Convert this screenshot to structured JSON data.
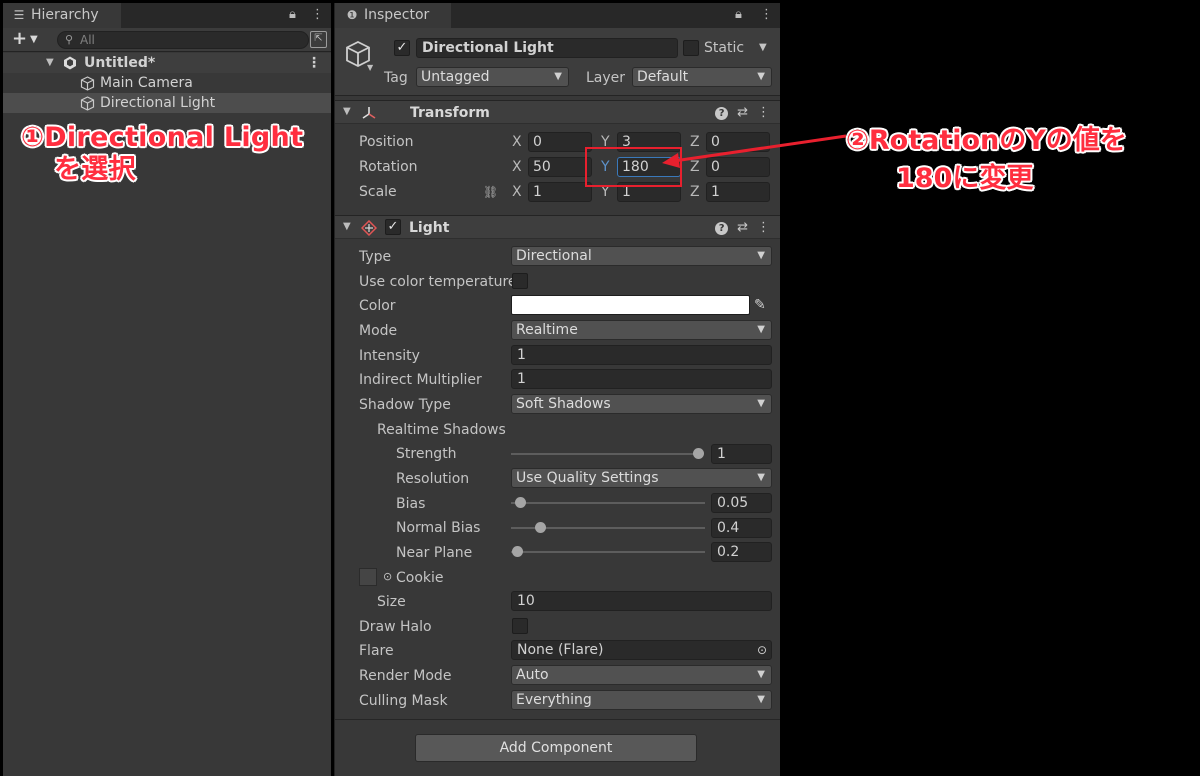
{
  "hierarchy": {
    "tab_label": "Hierarchy",
    "search_placeholder": "All",
    "scene_name": "Untitled*",
    "items": [
      "Main Camera",
      "Directional Light"
    ]
  },
  "inspector": {
    "tab_label": "Inspector",
    "object_name": "Directional Light",
    "static_label": "Static",
    "tag_label": "Tag",
    "tag_value": "Untagged",
    "layer_label": "Layer",
    "layer_value": "Default",
    "transform": {
      "title": "Transform",
      "position_label": "Position",
      "rotation_label": "Rotation",
      "scale_label": "Scale",
      "axes": [
        "X",
        "Y",
        "Z"
      ],
      "position": [
        "0",
        "3",
        "0"
      ],
      "rotation": [
        "50",
        "180",
        "0"
      ],
      "scale": [
        "1",
        "1",
        "1"
      ]
    },
    "light": {
      "title": "Light",
      "type_label": "Type",
      "type_value": "Directional",
      "color_temp_label": "Use color temperature",
      "color_label": "Color",
      "color_value": "#ffffff",
      "mode_label": "Mode",
      "mode_value": "Realtime",
      "intensity_label": "Intensity",
      "intensity_value": "1",
      "indirect_label": "Indirect Multiplier",
      "indirect_value": "1",
      "shadow_type_label": "Shadow Type",
      "shadow_type_value": "Soft Shadows",
      "realtime_shadows_label": "Realtime Shadows",
      "strength_label": "Strength",
      "strength_value": "1",
      "resolution_label": "Resolution",
      "resolution_value": "Use Quality Settings",
      "bias_label": "Bias",
      "bias_value": "0.05",
      "normal_bias_label": "Normal Bias",
      "normal_bias_value": "0.4",
      "near_plane_label": "Near Plane",
      "near_plane_value": "0.2",
      "cookie_label": "Cookie",
      "size_label": "Size",
      "size_value": "10",
      "draw_halo_label": "Draw Halo",
      "flare_label": "Flare",
      "flare_value": "None (Flare)",
      "render_mode_label": "Render Mode",
      "render_mode_value": "Auto",
      "culling_mask_label": "Culling Mask",
      "culling_mask_value": "Everything"
    },
    "add_component_label": "Add Component"
  },
  "annotations": {
    "step1_line1": "①Directional Light",
    "step1_line2": "を選択",
    "step2_line1": "②RotationのYの値を",
    "step2_line2": "180に変更",
    "accent_color": "#ff2e3f"
  }
}
